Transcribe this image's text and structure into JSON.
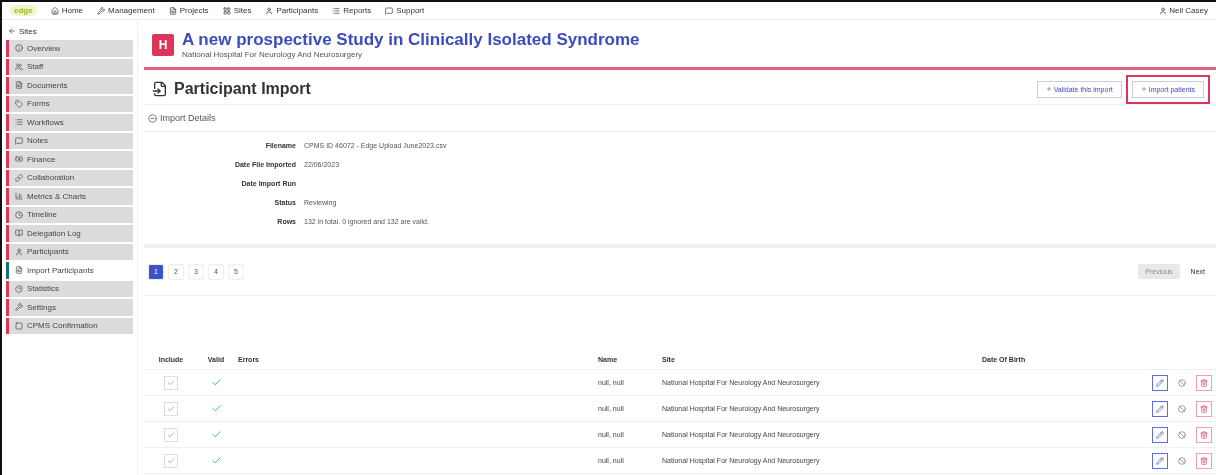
{
  "top_nav": {
    "brand": "edge",
    "items": [
      {
        "label": "Home"
      },
      {
        "label": "Management"
      },
      {
        "label": "Projects"
      },
      {
        "label": "Sites"
      },
      {
        "label": "Participants"
      },
      {
        "label": "Reports"
      },
      {
        "label": "Support"
      }
    ],
    "user": "Neil Casey"
  },
  "sidebar": {
    "back": "Sites",
    "items": [
      {
        "label": "Overview",
        "selected": false
      },
      {
        "label": "Staff",
        "selected": false
      },
      {
        "label": "Documents",
        "selected": false
      },
      {
        "label": "Forms",
        "selected": false
      },
      {
        "label": "Workflows",
        "selected": false
      },
      {
        "label": "Notes",
        "selected": false
      },
      {
        "label": "Finance",
        "selected": false
      },
      {
        "label": "Collaboration",
        "selected": false
      },
      {
        "label": "Metrics & Charts",
        "selected": false
      },
      {
        "label": "Timeline",
        "selected": false
      },
      {
        "label": "Delegation Log",
        "selected": false
      },
      {
        "label": "Participants",
        "selected": false
      },
      {
        "label": "Import Participants",
        "selected": true
      },
      {
        "label": "Statistics",
        "selected": false
      },
      {
        "label": "Settings",
        "selected": false
      },
      {
        "label": "CPMS Confirmation",
        "selected": false
      }
    ]
  },
  "project": {
    "logo": "H",
    "title": "A new prospective Study in Clinically Isolated Syndrome",
    "subtitle": "National Hospital For Neurology And Neurosurgery"
  },
  "page_title": "Participant Import",
  "actions": [
    {
      "label": "Validate this import",
      "highlighted": false
    },
    {
      "label": "Import patients",
      "highlighted": true
    }
  ],
  "details": {
    "title": "Import Details",
    "fields": [
      {
        "label": "Filename",
        "value": "CPMS ID 46072 - Edge Upload June2023.csv"
      },
      {
        "label": "Date File Imported",
        "value": "22/06/2023"
      },
      {
        "label": "Date Import Run"
      },
      {
        "label": "Status",
        "value": "Reviewing"
      },
      {
        "label": "Rows",
        "value": "132 in total. 0 ignored and 132 are valid."
      }
    ]
  },
  "pagination": {
    "pages": [
      {
        "label": "1",
        "selected": true
      },
      {
        "label": "2",
        "selected": false
      },
      {
        "label": "3",
        "selected": false
      },
      {
        "label": "4",
        "selected": false
      },
      {
        "label": "5",
        "selected": false
      }
    ],
    "previous": {
      "label": "Previous",
      "disabled": true
    },
    "next": {
      "label": "Next",
      "disabled": false
    }
  },
  "table": {
    "columns": [
      "Include",
      "Valid",
      "Errors",
      "Name",
      "Site",
      "Date Of Birth"
    ],
    "rows": [
      {
        "include": true,
        "valid": true,
        "name": "null, null",
        "site": "National Hospital For Neurology And Neurosurgery"
      },
      {
        "include": true,
        "valid": true,
        "name": "null, null",
        "site": "National Hospital For Neurology And Neurosurgery"
      },
      {
        "include": true,
        "valid": true,
        "name": "null, null",
        "site": "National Hospital For Neurology And Neurosurgery"
      },
      {
        "include": true,
        "valid": true,
        "name": "null, null",
        "site": "National Hospital For Neurology And Neurosurgery"
      }
    ]
  }
}
